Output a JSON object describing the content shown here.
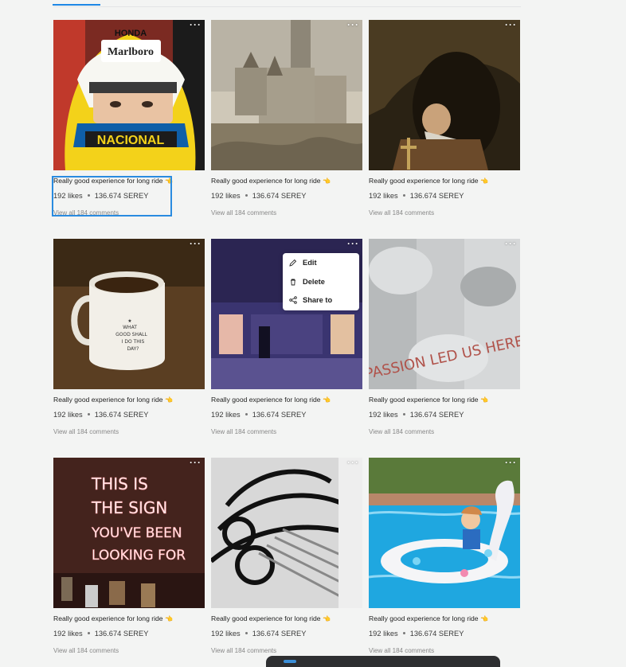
{
  "posts": [
    {
      "caption": "Really good experience for long ride",
      "emoji": "👈",
      "likes": "192 likes",
      "amount": "136.674 SEREY",
      "comments": "View all 184 comments",
      "more": "···"
    },
    {
      "caption": "Really good experience for long ride",
      "emoji": "👈",
      "likes": "192 likes",
      "amount": "136.674 SEREY",
      "comments": "View all 184 comments",
      "more": "···"
    },
    {
      "caption": "Really good experience for long ride",
      "emoji": "👈",
      "likes": "192 likes",
      "amount": "136.674 SEREY",
      "comments": "View all 184 comments",
      "more": "···"
    },
    {
      "caption": "Really good experience for long ride",
      "emoji": "👈",
      "likes": "192 likes",
      "amount": "136.674 SEREY",
      "comments": "View all 184 comments",
      "more": "···"
    },
    {
      "caption": "Really good experience for long ride",
      "emoji": "👈",
      "likes": "192 likes",
      "amount": "136.674 SEREY",
      "comments": "View all 184 comments",
      "more": "···"
    },
    {
      "caption": "Really good experience for long ride",
      "emoji": "👈",
      "likes": "192 likes",
      "amount": "136.674 SEREY",
      "comments": "View all 184 comments",
      "more": "···"
    },
    {
      "caption": "Really good experience for long ride",
      "emoji": "👈",
      "likes": "192 likes",
      "amount": "136.674 SEREY",
      "comments": "View all 184 comments",
      "more": "···"
    },
    {
      "caption": "Really good experience for long ride",
      "emoji": "👈",
      "likes": "192 likes",
      "amount": "136.674 SEREY",
      "comments": "View all 184 comments",
      "more": "···"
    },
    {
      "caption": "Really good experience for long ride",
      "emoji": "👈",
      "likes": "192 likes",
      "amount": "136.674 SEREY",
      "comments": "View all 184 comments",
      "more": "···"
    }
  ],
  "image_text": {
    "helmet_top": "HONDA",
    "helmet_sponsor": "Marlboro",
    "helmet_band": "NACIONAL",
    "mug_lines": [
      "WHAT",
      "GOOD SHALL",
      "I DO THIS",
      "DAY?"
    ],
    "wall_text": "PASSION LED US HERE",
    "neon_lines": [
      "THIS IS",
      "THE SIGN",
      "YOU'VE BEEN",
      "LOOKING FOR"
    ]
  },
  "context_menu": {
    "items": [
      {
        "label": "Edit",
        "icon": "pencil-icon"
      },
      {
        "label": "Delete",
        "icon": "trash-icon"
      },
      {
        "label": "Share to",
        "icon": "share-icon"
      }
    ]
  },
  "colors": {
    "accent": "#1e88e5",
    "selection": "#2a8be0"
  }
}
